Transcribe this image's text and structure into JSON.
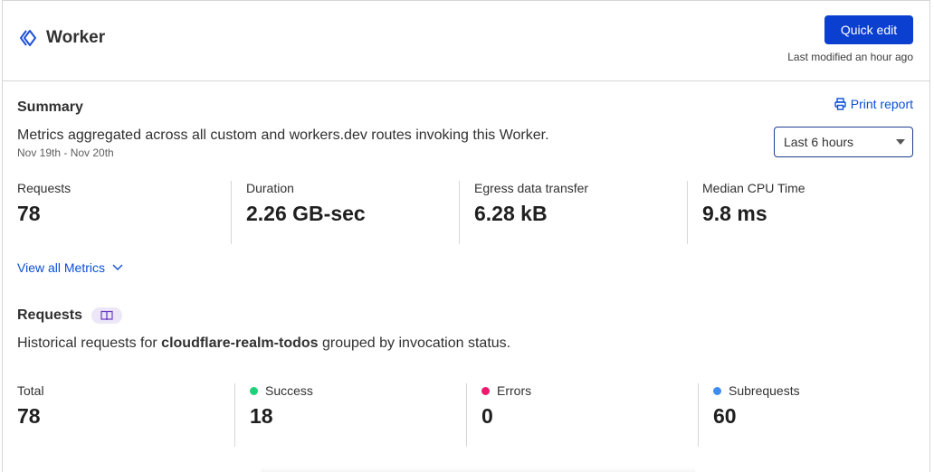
{
  "header": {
    "title": "Worker",
    "quick_edit_label": "Quick edit",
    "last_modified": "Last modified an hour ago",
    "icon": "worker-chevrons-icon"
  },
  "summary": {
    "title": "Summary",
    "description": "Metrics aggregated across all custom and workers.dev routes invoking this Worker.",
    "date_range": "Nov 19th - Nov 20th",
    "print_report_label": "Print report",
    "time_range_selected": "Last 6 hours",
    "metrics": [
      {
        "label": "Requests",
        "value": "78"
      },
      {
        "label": "Duration",
        "value": "2.26 GB-sec"
      },
      {
        "label": "Egress data transfer",
        "value": "6.28 kB"
      },
      {
        "label": "Median CPU Time",
        "value": "9.8 ms"
      }
    ],
    "view_all_label": "View all Metrics"
  },
  "requests": {
    "title": "Requests",
    "desc_prefix": "Historical requests for ",
    "worker_name": "cloudflare-realm-todos",
    "desc_suffix": " grouped by invocation status.",
    "stats": [
      {
        "label": "Total",
        "value": "78",
        "color": ""
      },
      {
        "label": "Success",
        "value": "18",
        "color": "#1ed07a"
      },
      {
        "label": "Errors",
        "value": "0",
        "color": "#f0176f"
      },
      {
        "label": "Subrequests",
        "value": "60",
        "color": "#3d8ef0"
      }
    ]
  },
  "colors": {
    "primary": "#0b3fd0",
    "link": "#0b4fd6",
    "border": "#d6d6d6"
  }
}
